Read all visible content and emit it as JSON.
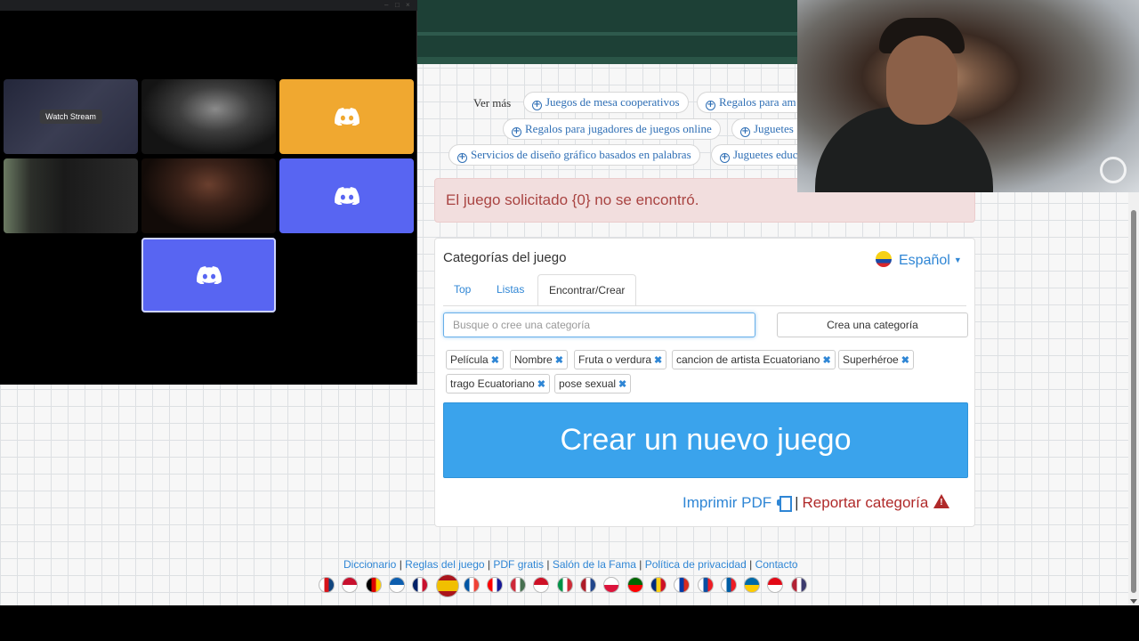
{
  "discord": {
    "watch_stream_label": "Watch Stream"
  },
  "suggestions": {
    "see_more": "Ver más",
    "pills": [
      "Juegos de mesa cooperativos",
      "Regalos para am",
      "Regalos para jugadores de juegos online",
      "Juguetes",
      "Servicios de diseño gráfico basados en palabras",
      "Juguetes educ"
    ]
  },
  "alert": {
    "message": "El juego solicitado {0} no se encontró."
  },
  "panel": {
    "title": "Categorías del juego",
    "language": "Español",
    "tabs": [
      "Top",
      "Listas",
      "Encontrar/Crear"
    ],
    "search_placeholder": "Busque o cree una categoría",
    "create_category_label": "Crea una categoría",
    "tags": [
      "Película",
      "Nombre",
      "Fruta o verdura",
      "cancion de artista Ecuatoriano",
      "Superhéroe",
      "trago Ecuatoriano",
      "pose sexual"
    ],
    "create_game_label": "Crear un nuevo juego",
    "print_pdf": "Imprimir PDF",
    "separator": "|",
    "report_category": "Reportar categoría"
  },
  "footer": {
    "links": [
      "Diccionario",
      "Reglas del juego",
      "PDF gratis",
      "Salón de la Fama",
      "Política de privacidad",
      "Contacto"
    ]
  },
  "flags": [
    {
      "name": "czech-flag-icon",
      "colors": [
        "#ffffff",
        "#d7141a",
        "#11457e"
      ]
    },
    {
      "name": "denmark-flag-icon",
      "colors": [
        "#c8102e",
        "#ffffff"
      ]
    },
    {
      "name": "germany-flag-icon",
      "colors": [
        "#000000",
        "#dd0000",
        "#ffce00"
      ]
    },
    {
      "name": "greece-flag-icon",
      "colors": [
        "#0d5eaf",
        "#ffffff"
      ]
    },
    {
      "name": "uk-flag-icon",
      "colors": [
        "#012169",
        "#ffffff",
        "#c8102e"
      ]
    },
    {
      "name": "spain-flag-icon",
      "colors": [
        "#aa151b",
        "#f1bf00",
        "#aa151b"
      ]
    },
    {
      "name": "france-flag-icon",
      "colors": [
        "#0055a4",
        "#ffffff",
        "#ef4135"
      ]
    },
    {
      "name": "croatia-flag-icon",
      "colors": [
        "#ff0000",
        "#ffffff",
        "#171796"
      ]
    },
    {
      "name": "hungary-flag-icon",
      "colors": [
        "#ce2939",
        "#ffffff",
        "#477050"
      ]
    },
    {
      "name": "indonesia-flag-icon",
      "colors": [
        "#ce1126",
        "#ffffff"
      ]
    },
    {
      "name": "italy-flag-icon",
      "colors": [
        "#009246",
        "#ffffff",
        "#ce2b37"
      ]
    },
    {
      "name": "netherlands-flag-icon",
      "colors": [
        "#ae1c28",
        "#ffffff",
        "#21468b"
      ]
    },
    {
      "name": "poland-flag-icon",
      "colors": [
        "#ffffff",
        "#dc143c"
      ]
    },
    {
      "name": "portugal-flag-icon",
      "colors": [
        "#006600",
        "#ff0000"
      ]
    },
    {
      "name": "romania-flag-icon",
      "colors": [
        "#002b7f",
        "#fcd116",
        "#ce1126"
      ]
    },
    {
      "name": "russia-flag-icon",
      "colors": [
        "#ffffff",
        "#0039a6",
        "#d52b1e"
      ]
    },
    {
      "name": "slovakia-flag-icon",
      "colors": [
        "#ffffff",
        "#0b4ea2",
        "#ee1c25"
      ]
    },
    {
      "name": "slovenia-flag-icon",
      "colors": [
        "#ffffff",
        "#005da4",
        "#ed1c24"
      ]
    },
    {
      "name": "sweden-flag-icon",
      "colors": [
        "#006aa7",
        "#fecc00"
      ]
    },
    {
      "name": "turkey-flag-icon",
      "colors": [
        "#e30a17",
        "#ffffff"
      ]
    },
    {
      "name": "usa-flag-icon",
      "colors": [
        "#b22234",
        "#ffffff",
        "#3c3b6e"
      ]
    }
  ],
  "colors": {
    "accent": "#2f86d5",
    "primary_button": "#3aa3ec",
    "alert_bg": "#f2dede",
    "alert_text": "#a94442",
    "danger": "#b02a2a",
    "navbar": "#1d4036",
    "discord_blurple": "#5865f2",
    "discord_gold": "#f0a830"
  }
}
